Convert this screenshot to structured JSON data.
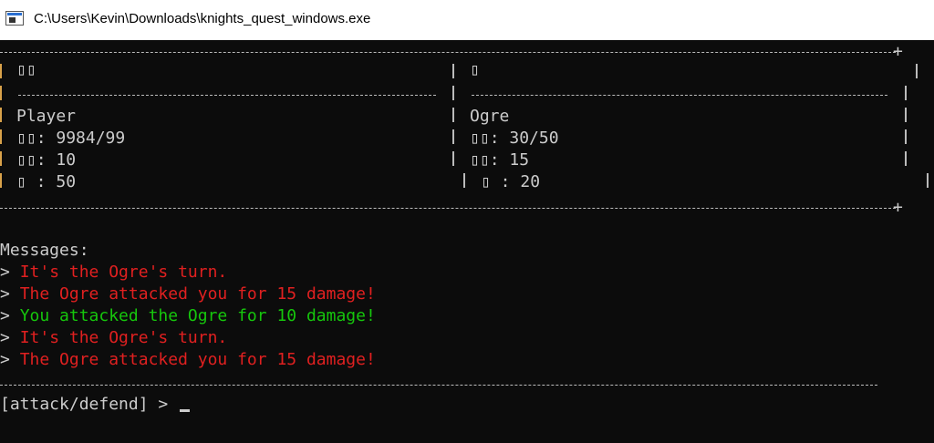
{
  "window": {
    "title": "C:\\Users\\Kevin\\Downloads\\knights_quest_windows.exe",
    "app_icon": "console-window-icon"
  },
  "panel_left": {
    "header": "▯▯",
    "name": "Player",
    "hp_label": "▯▯",
    "hp_value": "9984/99",
    "atk_label": "▯▯",
    "atk_value": "10",
    "def_label": "▯",
    "def_value": "50"
  },
  "panel_right": {
    "header": "▯",
    "name": "Ogre",
    "hp_label": "▯▯",
    "hp_value": "30/50",
    "atk_label": "▯▯",
    "atk_value": "15",
    "def_label": "▯",
    "def_value": "20"
  },
  "messages": {
    "heading": "Messages:",
    "prefix": ">",
    "items": [
      {
        "text": "It's the Ogre's turn.",
        "color": "#e02020"
      },
      {
        "text": "The Ogre attacked you for 15 damage!",
        "color": "#e02020"
      },
      {
        "text": "You attacked the Ogre for 10 damage!",
        "color": "#16c60c"
      },
      {
        "text": "It's the Ogre's turn.",
        "color": "#e02020"
      },
      {
        "text": "The Ogre attacked you for 15 damage!",
        "color": "#e02020"
      }
    ]
  },
  "prompt": {
    "text": "[attack/defend] > "
  },
  "colors": {
    "background": "#0c0c0c",
    "text": "#cccccc",
    "danger": "#e02020",
    "success": "#16c60c",
    "border_accent": "#d9a24a"
  }
}
